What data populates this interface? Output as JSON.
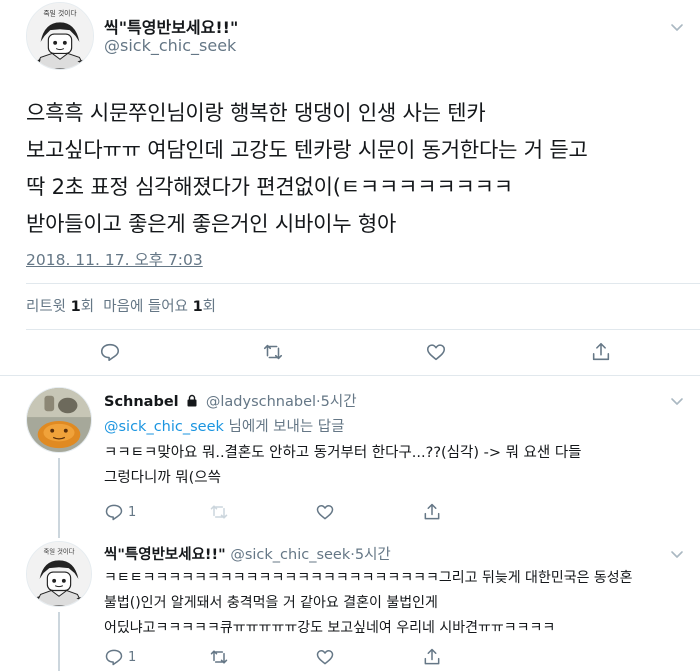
{
  "main": {
    "name": "씩\"특영반보세요!!\"",
    "handle": "@sick_chic_seek",
    "text": "으흑흑 시문쭈인님이랑 행복한 댕댕이 인생 사는 텐카\n보고싶다ㅠㅠ 여담인데 고강도 텐카랑 시문이 동거한다는 거 듣고\n딱 2초 표정 심각해졌다가 편견없이(ㅌㅋㅋㅋㅋㅋㅋㅋㅋ\n받아들이고 좋은게 좋은거인 시바이누 형아",
    "timestamp": "2018. 11. 17. 오후 7:03",
    "retweet_label": "리트윗",
    "retweet_count": "1",
    "retweet_unit": "회",
    "like_label": "마음에 들어요",
    "like_count": "1",
    "like_unit": "회",
    "avatar_caption": "죽일 것이다"
  },
  "replies": [
    {
      "name": "Schnabel",
      "handle": "@ladyschnabel",
      "time": "·5시간",
      "reply_to_mention": "@sick_chic_seek",
      "reply_to_suffix": " 님에게 보내는 답글",
      "text": "ㅋㅋㅌㅋ맞아요 뭐..결혼도 안하고 동거부터 한다구...??(심각) -> 뭐 요샌 다들\n그렁다니까 뭐(으쓱",
      "reply_count": "1"
    },
    {
      "name": "씩\"특영반보세요!!\"",
      "handle": "@sick_chic_seek",
      "time": "·5시간",
      "text": "ㅋㅌㅌㅋㅋㅋㅋㅋㅋㅋㅋㅋㅋㅋㅋㅋㅋㅋㅋㅋㅋㅋㅋㅋㅋㅋ그리고 뒤늦게 대한민국은 동성혼\n불법()인거 알게돼서 충격먹을 거 같아요 결혼이 불법인게\n어딨냐고ㅋㅋㅋㅋㅋ큐ㅠㅠㅠㅠㅠ강도 보고싶네여 우리네 시바견ㅠㅠㅋㅋㅋㅋ",
      "reply_count": "1",
      "avatar_caption": "죽일 것이다"
    }
  ],
  "colors": {
    "link": "#1b95e0",
    "muted": "#657786",
    "text": "#14171a",
    "divider": "#e1e8ed"
  },
  "icons": [
    "reply-icon",
    "retweet-icon",
    "like-icon",
    "share-icon",
    "lock-icon",
    "chevron-down-icon"
  ]
}
